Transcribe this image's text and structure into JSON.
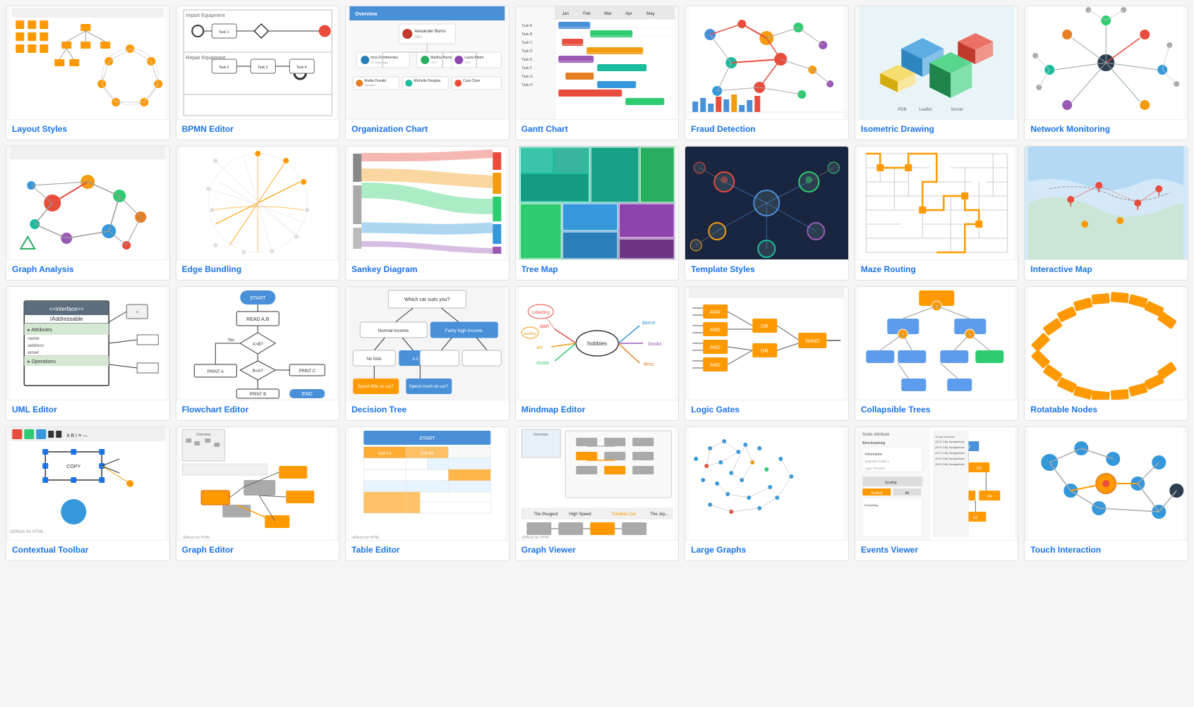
{
  "cards": [
    {
      "id": "layout-styles",
      "label": "Layout Styles",
      "type": "layout-styles"
    },
    {
      "id": "bpmn-editor",
      "label": "BPMN Editor",
      "type": "bpmn"
    },
    {
      "id": "organization-chart",
      "label": "Organization Chart",
      "type": "org-chart"
    },
    {
      "id": "gantt-chart",
      "label": "Gantt Chart",
      "type": "gantt"
    },
    {
      "id": "fraud-detection",
      "label": "Fraud Detection",
      "type": "fraud"
    },
    {
      "id": "isometric-drawing",
      "label": "Isometric Drawing",
      "type": "isometric"
    },
    {
      "id": "network-monitoring",
      "label": "Network Monitoring",
      "type": "network"
    },
    {
      "id": "graph-analysis",
      "label": "Graph Analysis",
      "type": "graph-analysis"
    },
    {
      "id": "edge-bundling",
      "label": "Edge Bundling",
      "type": "edge-bundling"
    },
    {
      "id": "sankey-diagram",
      "label": "Sankey Diagram",
      "type": "sankey"
    },
    {
      "id": "tree-map",
      "label": "Tree Map",
      "type": "treemap"
    },
    {
      "id": "template-styles",
      "label": "Template Styles",
      "type": "template-styles"
    },
    {
      "id": "maze-routing",
      "label": "Maze Routing",
      "type": "maze"
    },
    {
      "id": "interactive-map",
      "label": "Interactive Map",
      "type": "imap"
    },
    {
      "id": "uml-editor",
      "label": "UML Editor",
      "type": "uml"
    },
    {
      "id": "flowchart-editor",
      "label": "Flowchart Editor",
      "type": "flowchart"
    },
    {
      "id": "decision-tree",
      "label": "Decision Tree",
      "type": "decision"
    },
    {
      "id": "mindmap-editor",
      "label": "Mindmap Editor",
      "type": "mindmap"
    },
    {
      "id": "logic-gates",
      "label": "Logic Gates",
      "type": "logic"
    },
    {
      "id": "collapsible-trees",
      "label": "Collapsible Trees",
      "type": "collapsible"
    },
    {
      "id": "rotatable-nodes",
      "label": "Rotatable Nodes",
      "type": "rotatable"
    },
    {
      "id": "contextual-toolbar",
      "label": "Contextual Toolbar",
      "type": "toolbar"
    },
    {
      "id": "graph-editor",
      "label": "Graph Editor",
      "type": "graph-editor"
    },
    {
      "id": "table-editor",
      "label": "Table Editor",
      "type": "table-editor"
    },
    {
      "id": "graph-viewer",
      "label": "Graph Viewer",
      "type": "graph-viewer"
    },
    {
      "id": "large-graphs",
      "label": "Large Graphs",
      "type": "large-graphs"
    },
    {
      "id": "events-viewer",
      "label": "Events Viewer",
      "type": "events"
    },
    {
      "id": "touch-interaction",
      "label": "Touch Interaction",
      "type": "touch"
    }
  ]
}
